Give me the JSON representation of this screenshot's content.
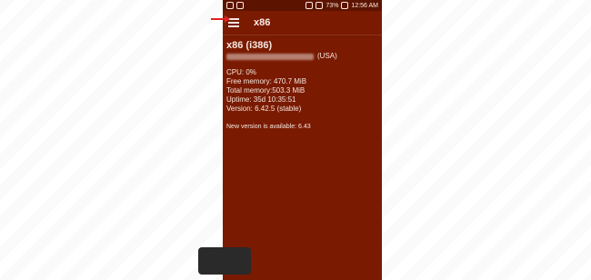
{
  "status_bar": {
    "battery": "73%",
    "time": "12:56 AM"
  },
  "toolbar": {
    "title": "x86"
  },
  "device": {
    "name": "x86 (i386)",
    "region": "(USA)"
  },
  "stats": [
    "CPU: 0%",
    "Free memory: 470.7 MiB",
    "Total memory:503.3 MiB",
    "Uptime: 35d 10:35:51",
    "Version: 6.42.5 (stable)"
  ],
  "update_notice": "New version is available: 6.43",
  "colors": {
    "accent": "#7a1a00",
    "status_bar": "#5c1400",
    "arrow": "#e02020"
  }
}
